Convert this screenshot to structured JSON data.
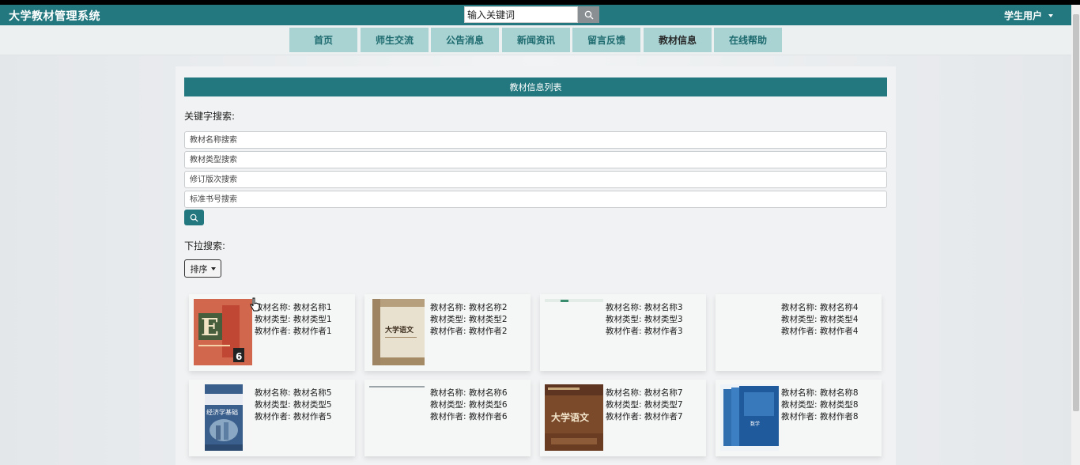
{
  "app": {
    "title": "大学教材管理系统",
    "user_label": "学生用户"
  },
  "top_search": {
    "placeholder": "输入关键词"
  },
  "nav": [
    "首页",
    "师生交流",
    "公告消息",
    "新闻资讯",
    "留言反馈",
    "教材信息",
    "在线帮助"
  ],
  "nav_active_index": 5,
  "panel": {
    "title": "教材信息列表",
    "keyword_label": "关键字搜索:",
    "fields": [
      "教材名称搜索",
      "教材类型搜索",
      "修订版次搜索",
      "标准书号搜索"
    ],
    "dropdown_label": "下拉搜索:",
    "sort_label": "排序"
  },
  "colors": {
    "teal": "#23787f",
    "nav_bg": "#a9d3d3"
  },
  "books": [
    {
      "name_label": "教材名称:",
      "name": "教材名称1",
      "type_label": "教材类型:",
      "type": "教材类型1",
      "author_label": "教材作者:",
      "author": "教材作者1",
      "cover": "english-textbook"
    },
    {
      "name_label": "教材名称:",
      "name": "教材名称2",
      "type_label": "教材类型:",
      "type": "教材类型2",
      "author_label": "教材作者:",
      "author": "教材作者2",
      "cover": "chinese-textbook"
    },
    {
      "name_label": "教材名称:",
      "name": "教材名称3",
      "type_label": "教材类型:",
      "type": "教材类型3",
      "author_label": "教材作者:",
      "author": "教材作者3",
      "cover": "blank-partial"
    },
    {
      "name_label": "教材名称:",
      "name": "教材名称4",
      "type_label": "教材类型:",
      "type": "教材类型4",
      "author_label": "教材作者:",
      "author": "教材作者4",
      "cover": "none"
    },
    {
      "name_label": "教材名称:",
      "name": "教材名称5",
      "type_label": "教材类型:",
      "type": "教材类型5",
      "author_label": "教材作者:",
      "author": "教材作者5",
      "cover": "economics-textbook"
    },
    {
      "name_label": "教材名称:",
      "name": "教材名称6",
      "type_label": "教材类型:",
      "type": "教材类型6",
      "author_label": "教材作者:",
      "author": "教材作者6",
      "cover": "blank-partial"
    },
    {
      "name_label": "教材名称:",
      "name": "教材名称7",
      "type_label": "教材类型:",
      "type": "教材类型7",
      "author_label": "教材作者:",
      "author": "教材作者7",
      "cover": "chinese-textbook-brown"
    },
    {
      "name_label": "教材名称:",
      "name": "教材名称8",
      "type_label": "教材类型:",
      "type": "教材类型8",
      "author_label": "教材作者:",
      "author": "教材作者8",
      "cover": "blue-box-set"
    }
  ]
}
